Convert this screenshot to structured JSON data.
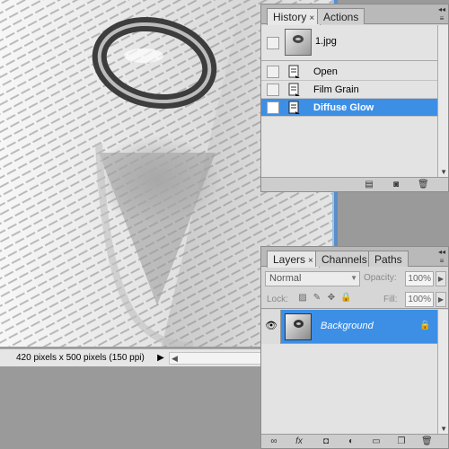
{
  "document": {
    "status_text": "420 pixels x 500 pixels (150 ppi)",
    "status_arrow": "▶",
    "scroll_left": "◀"
  },
  "history_panel": {
    "tabs": [
      {
        "label": "History",
        "active": true,
        "close": "×"
      },
      {
        "label": "Actions",
        "active": false
      }
    ],
    "snapshot": {
      "label": "1.jpg"
    },
    "states": [
      {
        "label": "Open",
        "selected": false
      },
      {
        "label": "Film Grain",
        "selected": false
      },
      {
        "label": "Diffuse Glow",
        "selected": true
      }
    ],
    "current_state_marker": "▷",
    "footer_icons": [
      "new-document-from-state-icon",
      "camera-icon",
      "trash-icon"
    ]
  },
  "layers_panel": {
    "tabs": [
      {
        "label": "Layers",
        "active": true,
        "close": "×"
      },
      {
        "label": "Channels",
        "active": false
      },
      {
        "label": "Paths",
        "active": false
      }
    ],
    "blend_mode": "Normal",
    "opacity_label": "Opacity:",
    "opacity_value": "100%",
    "lock_label": "Lock:",
    "fill_label": "Fill:",
    "fill_value": "100%",
    "layers": [
      {
        "name": "Background",
        "visible": true,
        "locked": true,
        "selected": true
      }
    ],
    "footer_icons": [
      "link-icon",
      "fx-icon",
      "mask-icon",
      "adjustment-icon",
      "folder-icon",
      "new-layer-icon",
      "trash-icon"
    ],
    "fx_text": "fx"
  },
  "colors": {
    "selection_blue": "#3d8fe6",
    "panel_gray": "#d6d6d6",
    "workspace_gray": "#9a9a9a"
  }
}
